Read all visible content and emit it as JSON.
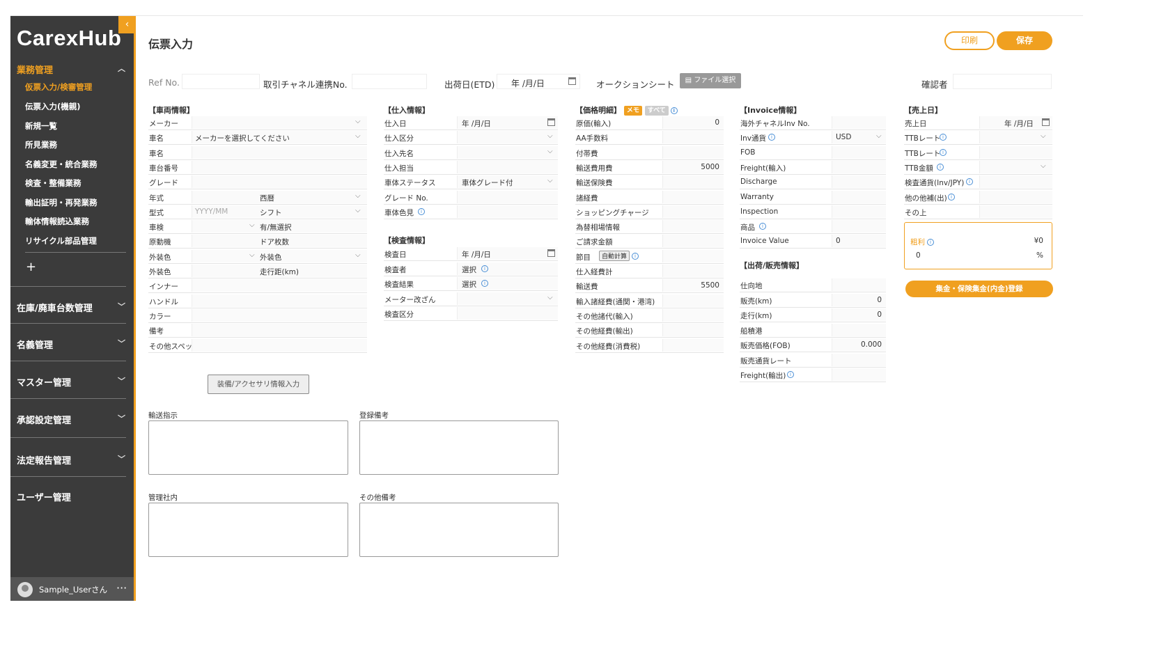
{
  "sidebar": {
    "logo": "CarexHub",
    "sections": [
      {
        "label": "業務管理",
        "active": true,
        "items": [
          {
            "label": "仮票入力/検審管理",
            "active": true
          },
          {
            "label": "伝票入力(機親)"
          },
          {
            "label": "新規一覧"
          },
          {
            "label": "所見業務"
          },
          {
            "label": "名義変更・統合業務"
          },
          {
            "label": "検査・整備業務"
          },
          {
            "label": "輸出証明・再発業務"
          },
          {
            "label": "輸体情報読込業務"
          },
          {
            "label": "リサイクル部品管理"
          }
        ]
      },
      {
        "label": "在庫/廃車台数管理"
      },
      {
        "label": "名義管理"
      },
      {
        "label": "マスター管理"
      },
      {
        "label": "承認設定管理"
      },
      {
        "label": "法定報告管理"
      },
      {
        "label": "ユーザー管理"
      }
    ],
    "plus": "+",
    "collapse": "‹",
    "user": "Sample_Userさん",
    "more": "···"
  },
  "header": {
    "title": "伝票入力",
    "print": "印刷",
    "save": "保存"
  },
  "top": {
    "ref": "Ref No.",
    "channel": "取引チャネル連携No.",
    "etd": "出荷日(ETD)",
    "etd_value": "年 /月/日",
    "auction": "オークションシート",
    "file": "ファイル選択",
    "confirmer": "確認者"
  },
  "vehicle": {
    "title": "【車両情報】",
    "rows": [
      {
        "label": "メーカー"
      },
      {
        "label": "車名",
        "value": "メーカーを選択してください"
      },
      {
        "label": "車名"
      },
      {
        "label": "車台番号"
      },
      {
        "label": "グレード"
      },
      {
        "label": "年式",
        "mid": "西暦"
      },
      {
        "label": "型式",
        "placeholder": "YYYY/MM",
        "mid": "シフト"
      },
      {
        "label": "車検",
        "mid": "有/無選択"
      },
      {
        "label": "原動機",
        "mid": "ドア枚数"
      },
      {
        "label": "外装色",
        "mid": "外装色"
      },
      {
        "label": "外装色",
        "mid": "走行距(km)"
      },
      {
        "label": "インナー"
      },
      {
        "label": "ハンドル"
      },
      {
        "label": "カラー"
      },
      {
        "label": "備考"
      },
      {
        "label": "その他スペック"
      }
    ],
    "accessory_btn": "装備/アクセサリ情報入力"
  },
  "purchase": {
    "title": "【仕入情報】",
    "rows": [
      {
        "label": "仕入日",
        "value": "年 /月/日"
      },
      {
        "label": "仕入区分"
      },
      {
        "label": "仕入先名"
      },
      {
        "label": "仕入担当"
      },
      {
        "label": "車体ステータス",
        "value": "車体グレード付"
      },
      {
        "label": "グレード No."
      },
      {
        "label": "車体色見"
      }
    ]
  },
  "inspection": {
    "title": "【検査情報】",
    "rows": [
      {
        "label": "検査日",
        "value": "年 /月/日"
      },
      {
        "label": "検査者",
        "value": "選択"
      },
      {
        "label": "検査結果",
        "value": "選択"
      },
      {
        "label": "メーター改ざん"
      },
      {
        "label": "検査区分"
      }
    ]
  },
  "price": {
    "title": "【価格明細】",
    "memo": "メモ",
    "memo2": "すべて",
    "rows": [
      {
        "label": "原価(輸入)",
        "value": "0"
      },
      {
        "label": "AA手数料"
      },
      {
        "label": "付帯費"
      },
      {
        "label": "輸送費用費",
        "value": "5000"
      },
      {
        "label": "輸送保険費"
      },
      {
        "label": "諸経費"
      },
      {
        "label": "ショッピングチャージ"
      },
      {
        "label": "為替相場情報"
      },
      {
        "label": "ご請求金額"
      },
      {
        "label": "節目",
        "auto": "自動計算"
      },
      {
        "label": "仕入経費計"
      },
      {
        "label": "輸送費",
        "value": "5500"
      },
      {
        "label": "輸入諸経費(通関・港湾)"
      },
      {
        "label": "その他諸代(輸入)"
      },
      {
        "label": "その他経費(輸出)"
      },
      {
        "label": "その他経費(消費税)"
      }
    ]
  },
  "invoice": {
    "title": "【Invoice情報】",
    "rows": [
      {
        "label": "海外チャネルInv No."
      },
      {
        "label": "Inv通貨",
        "value": "USD"
      },
      {
        "label": "FOB"
      },
      {
        "label": "Freight(輸入)"
      },
      {
        "label": "Discharge"
      },
      {
        "label": "Warranty"
      },
      {
        "label": "Inspection"
      },
      {
        "label": "商品"
      },
      {
        "label": "Invoice Value",
        "value": "0"
      }
    ]
  },
  "shipping": {
    "title": "【出荷/販売情報】",
    "rows": [
      {
        "label": "仕向地"
      },
      {
        "label": "販売(km)",
        "value": "0"
      },
      {
        "label": "走行(km)",
        "value": "0"
      },
      {
        "label": "船積港"
      },
      {
        "label": "販売価格(FOB)",
        "value": "0.000"
      },
      {
        "label": "販売通貨レート"
      },
      {
        "label": "Freight(輸出)"
      }
    ]
  },
  "sales": {
    "title": "【売上日】",
    "rows": [
      {
        "label": "売上日",
        "value": "年 /月/日"
      },
      {
        "label": "TTBレート"
      },
      {
        "label": "TTBレート"
      },
      {
        "label": "TTB金額"
      },
      {
        "label": "検査通貨(Inv/JPY)"
      },
      {
        "label": "他の他補(出)"
      },
      {
        "label": "その上"
      }
    ],
    "profit_label": "粗利",
    "profit_value": "¥0",
    "profit_pct": "0",
    "pct": "%",
    "register": "集金・保険集金(内金)登録"
  },
  "notes": {
    "shipping": "輸送指示",
    "reg": "登録備考",
    "internal": "管理社内",
    "other": "その他備考"
  },
  "colors": {
    "accent": "#f0a020",
    "sidebar": "#3b3b3b"
  }
}
